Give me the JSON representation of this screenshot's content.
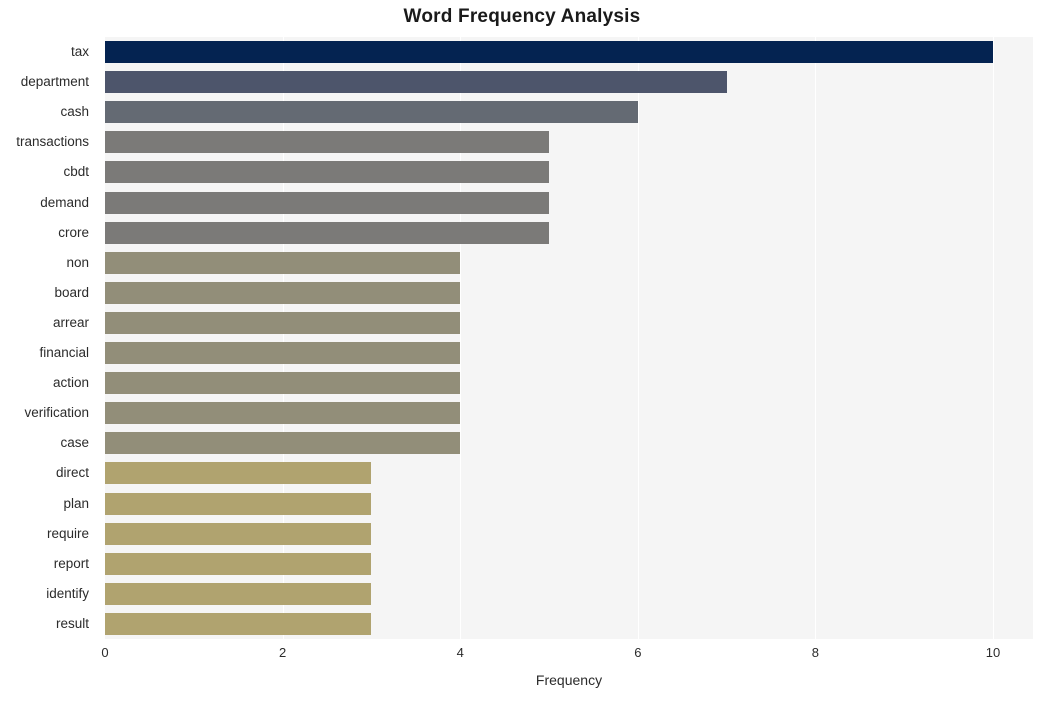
{
  "chart_data": {
    "type": "bar",
    "orientation": "horizontal",
    "title": "Word Frequency Analysis",
    "xlabel": "Frequency",
    "ylabel": "",
    "xlim": [
      0,
      10.45
    ],
    "xticks": [
      0,
      2,
      4,
      6,
      8,
      10
    ],
    "grid": true,
    "grid_axis": "x",
    "legend": "none",
    "categories": [
      "tax",
      "department",
      "cash",
      "transactions",
      "cbdt",
      "demand",
      "crore",
      "non",
      "board",
      "arrear",
      "financial",
      "action",
      "verification",
      "case",
      "direct",
      "plan",
      "require",
      "report",
      "identify",
      "result"
    ],
    "values": [
      10,
      7,
      6,
      5,
      5,
      5,
      5,
      4,
      4,
      4,
      4,
      4,
      4,
      4,
      3,
      3,
      3,
      3,
      3,
      3
    ],
    "bar_colors": [
      "#042351",
      "#4d556b",
      "#646a73",
      "#7b7a78",
      "#7b7a78",
      "#7b7a78",
      "#7b7a78",
      "#928e79",
      "#928e79",
      "#928e79",
      "#928e79",
      "#928e79",
      "#928e79",
      "#928e79",
      "#b0a36f",
      "#b0a36f",
      "#b0a36f",
      "#b0a36f",
      "#b0a36f",
      "#b0a36f"
    ]
  },
  "style": {
    "plot_background": "#f5f5f5",
    "figure_background": "#ffffff",
    "gridline_color": "#ffffff",
    "text_color": "#2b2b2b",
    "title_color": "#1a1a1a"
  }
}
